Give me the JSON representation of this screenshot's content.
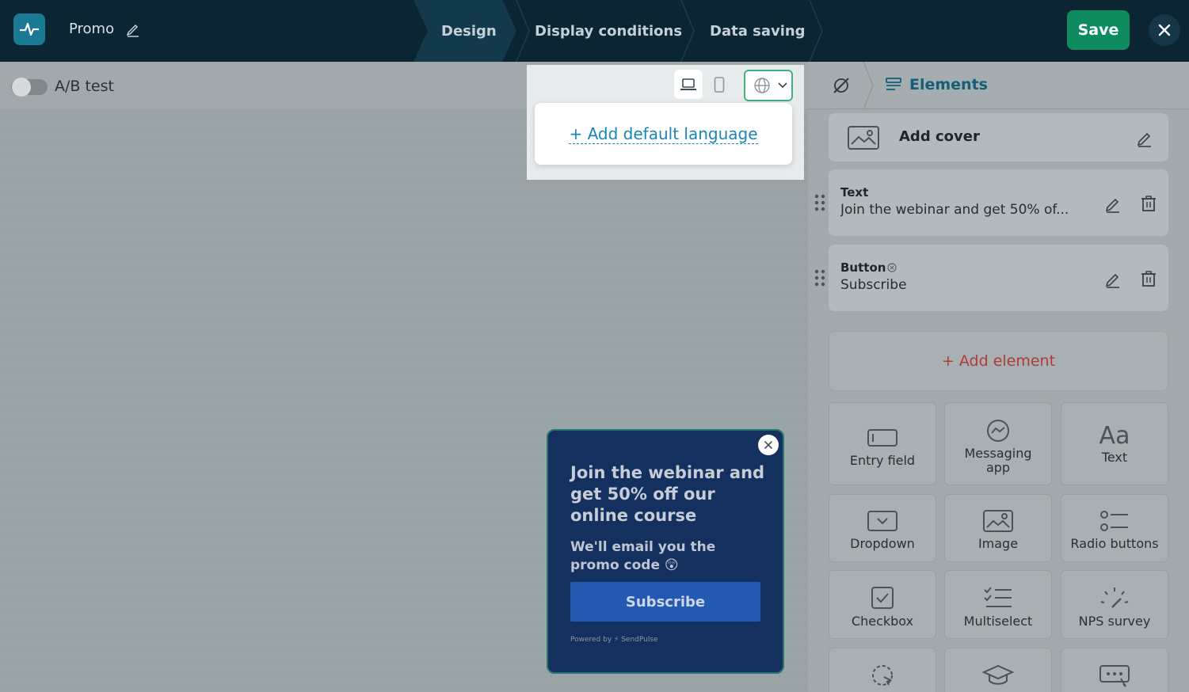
{
  "header": {
    "title": "Promo",
    "steps": [
      "Design",
      "Display conditions",
      "Data saving"
    ],
    "save_label": "Save"
  },
  "canvas": {
    "ab_test_label": "A/B test",
    "add_language_label": "+ Add default language"
  },
  "popup": {
    "title": "Join the webinar and get 50% off our online course",
    "subtitle": "We'll email you the promo code 😲",
    "button_label": "Subscribe",
    "powered_by": "Powered by ⚡ SendPulse"
  },
  "panel": {
    "tab_label": "Elements",
    "cover_label": "Add cover",
    "elements": [
      {
        "type": "Text",
        "value": "Join the webinar and get 50% of..."
      },
      {
        "type": "Button",
        "value": "Subscribe"
      }
    ],
    "add_element_label": "+ Add element",
    "tiles": [
      {
        "label": "Entry field",
        "icon": "entry-field-icon"
      },
      {
        "label": "Messaging app",
        "icon": "messaging-app-icon"
      },
      {
        "label": "Text",
        "icon": "text-icon"
      },
      {
        "label": "Dropdown",
        "icon": "dropdown-icon"
      },
      {
        "label": "Image",
        "icon": "image-icon"
      },
      {
        "label": "Radio buttons",
        "icon": "radio-buttons-icon"
      },
      {
        "label": "Checkbox",
        "icon": "checkbox-icon"
      },
      {
        "label": "Multiselect",
        "icon": "multiselect-icon"
      },
      {
        "label": "NPS survey",
        "icon": "nps-survey-icon"
      }
    ]
  },
  "colors": {
    "topbar": "#0c2533",
    "save": "#0f8c5f",
    "accent": "#135f77",
    "popup_bg": "#13305e",
    "popup_button": "#2359b0",
    "add_element": "#b03a3a"
  }
}
